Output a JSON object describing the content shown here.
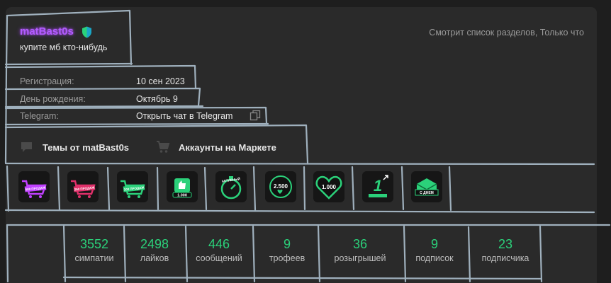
{
  "profile": {
    "username": "matBast0s",
    "status_text": "купите мб кто-нибудь",
    "viewing_status": "Смотрит список разделов, Только что"
  },
  "info": [
    {
      "label": "Регистрация:",
      "value": "10 сен 2023"
    },
    {
      "label": "День рождения:",
      "value": "Октябрь 9"
    },
    {
      "label": "Telegram:",
      "value": "Открыть чат в Telegram"
    }
  ],
  "links": {
    "topics": "Темы от matBast0s",
    "market": "Аккаунты на Маркете"
  },
  "badges": [
    {
      "icon": "cart-badge-icon",
      "text": "500 ПРОДАЖ",
      "color": "#c040ff"
    },
    {
      "icon": "cart-badge-icon",
      "text": "250 ПРОДАЖ",
      "color": "#e0306a"
    },
    {
      "icon": "cart-badge-icon",
      "text": "100 ПРОДАЖ",
      "color": "#2bd17a"
    },
    {
      "icon": "like-badge-icon",
      "text": "1.000",
      "color": "#2bd17a"
    },
    {
      "icon": "stopwatch-badge-icon",
      "text": "АКТИВНЫЙ",
      "color": "#2bd17a"
    },
    {
      "icon": "heart-badge-icon",
      "text": "2.500",
      "color": "#2bd17a"
    },
    {
      "icon": "heart-badge-icon",
      "text": "1.000",
      "color": "#2bd17a"
    },
    {
      "icon": "one-year-badge-icon",
      "text": "1",
      "color": "#2bd17a"
    },
    {
      "icon": "birthday-badge-icon",
      "text": "С ДНЕМ",
      "color": "#2bd17a"
    }
  ],
  "stats": [
    {
      "value": "3552",
      "label": "симпатии"
    },
    {
      "value": "2498",
      "label": "лайков"
    },
    {
      "value": "446",
      "label": "сообщений"
    },
    {
      "value": "9",
      "label": "трофеев"
    },
    {
      "value": "36",
      "label": "розыгрышей"
    },
    {
      "value": "9",
      "label": "подписок"
    },
    {
      "value": "23",
      "label": "подписчика"
    }
  ],
  "colors": {
    "accent_green": "#2bd17a",
    "username_purple": "#b25cff",
    "outline": "#9fb0bd"
  }
}
